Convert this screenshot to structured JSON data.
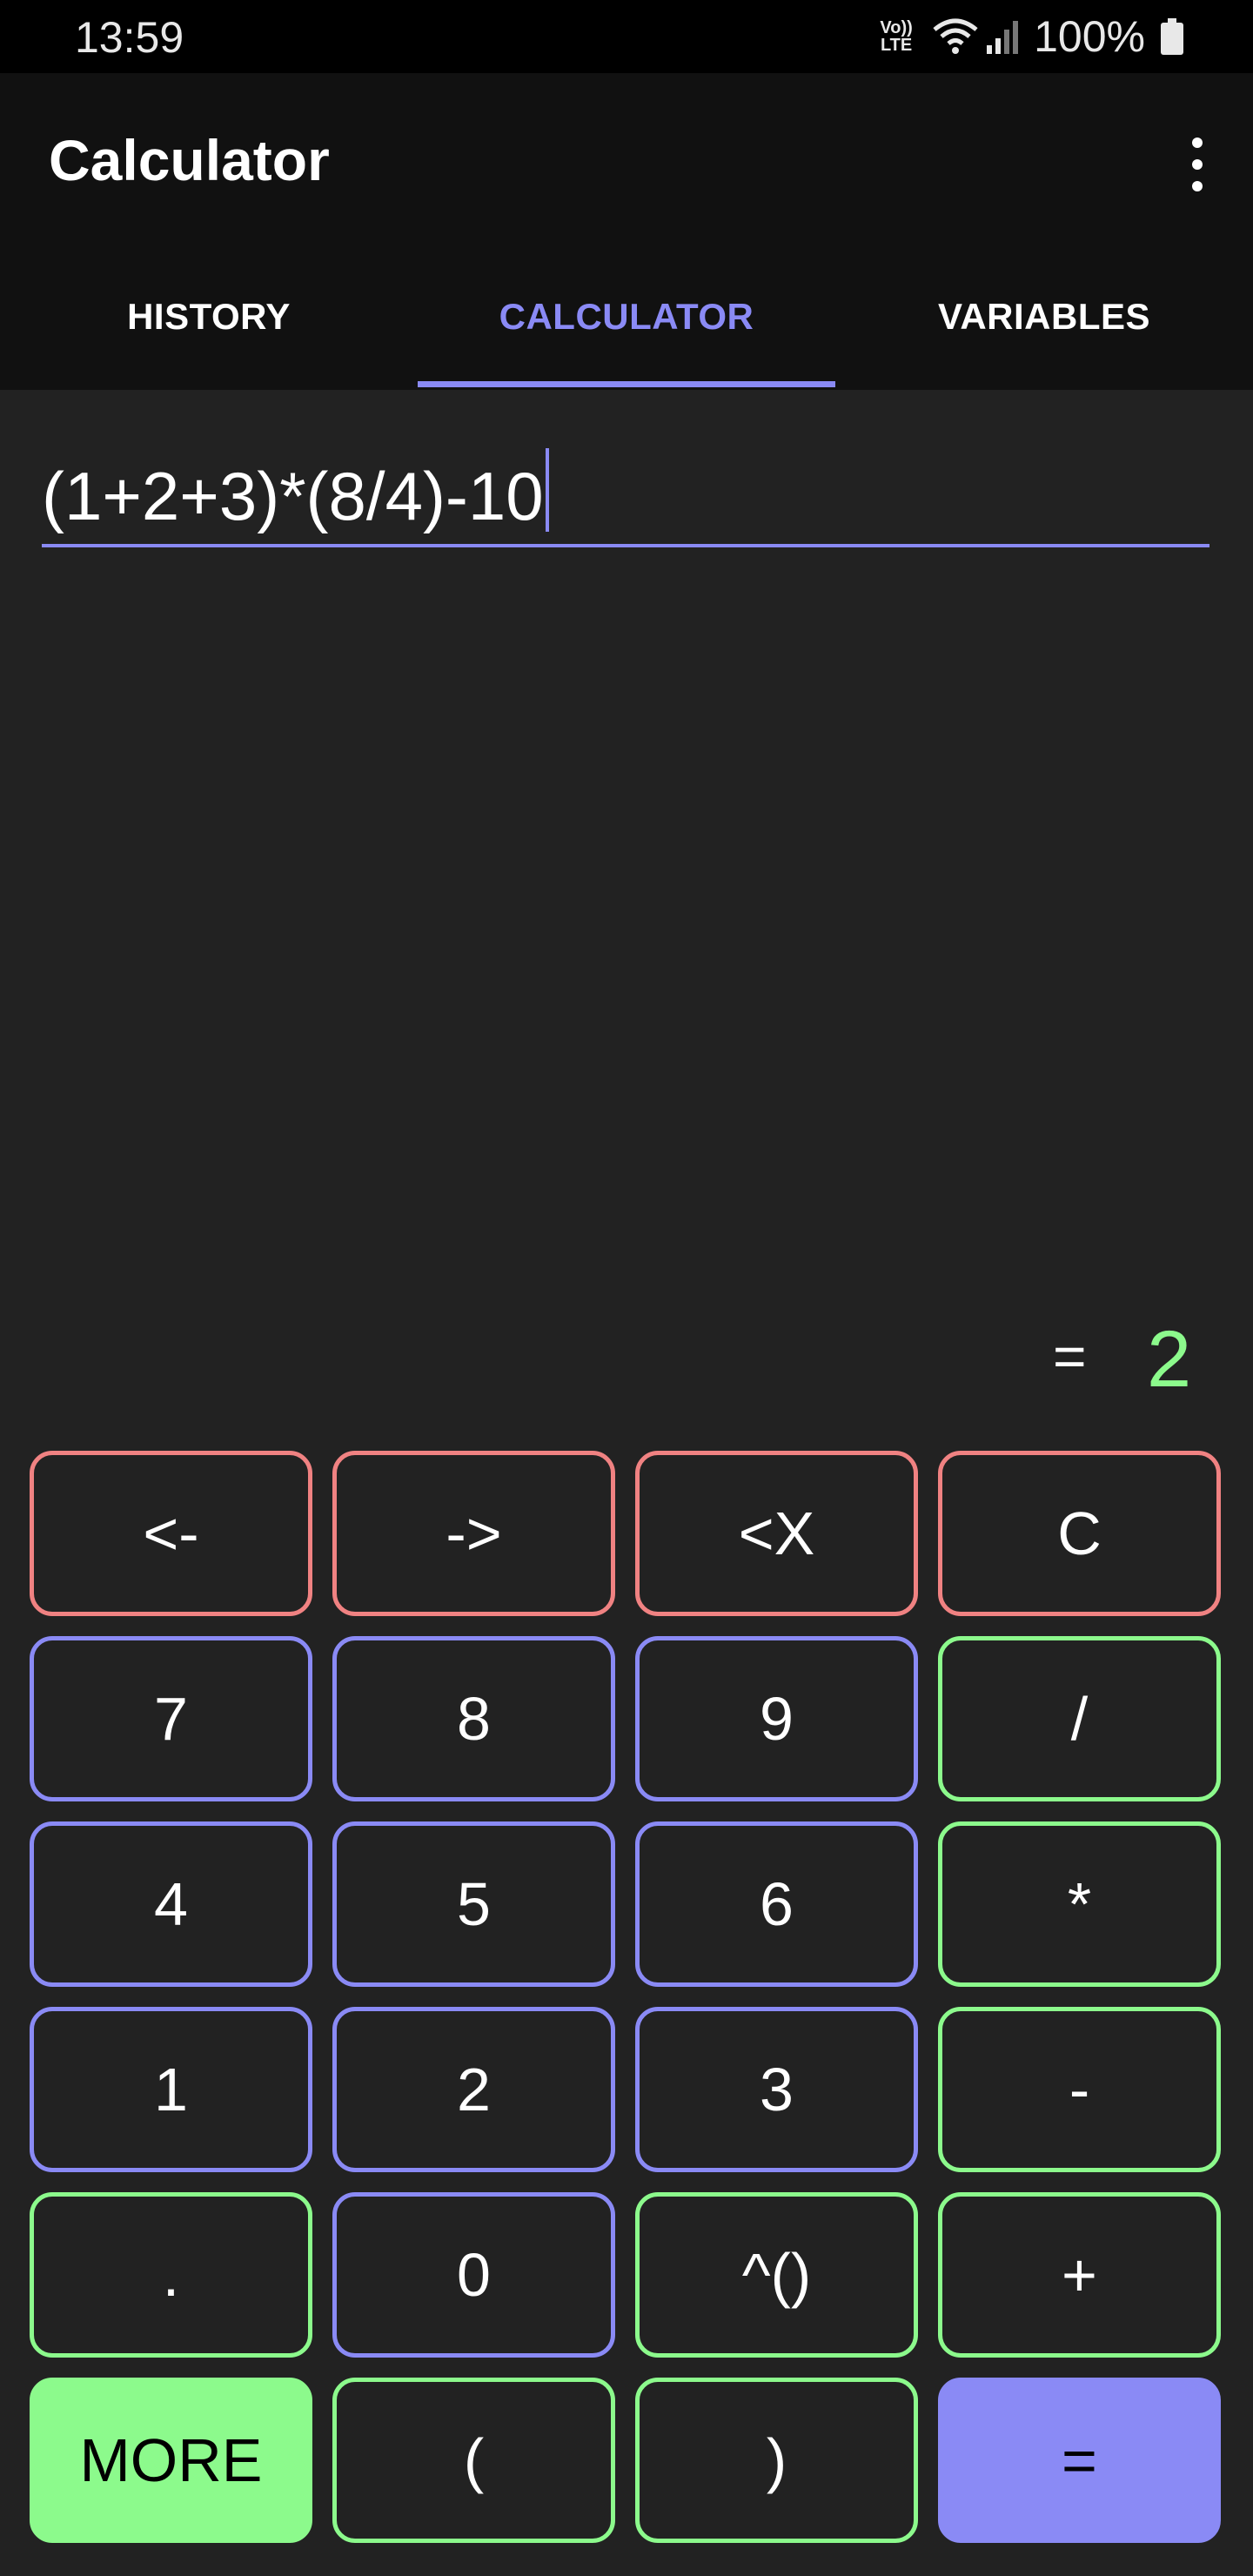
{
  "status": {
    "time": "13:59",
    "network": "Vo)) LTE",
    "battery": "100%"
  },
  "app": {
    "title": "Calculator"
  },
  "tabs": [
    "HISTORY",
    "CALCULATOR",
    "VARIABLES"
  ],
  "expression": "(1+2+3)*(8/4)-10",
  "result": {
    "equals": "=",
    "value": "2"
  },
  "keys": [
    "<-",
    "->",
    "<X",
    "C",
    "7",
    "8",
    "9",
    "/",
    "4",
    "5",
    "6",
    "*",
    "1",
    "2",
    "3",
    "-",
    ".",
    "0",
    "^()",
    "+",
    "MORE",
    "(",
    ")",
    "="
  ],
  "colors": {
    "accent": "#8a8af5",
    "green": "#8cfa8c",
    "red": "#f08282",
    "background": "#222222",
    "appbar": "#111111"
  }
}
